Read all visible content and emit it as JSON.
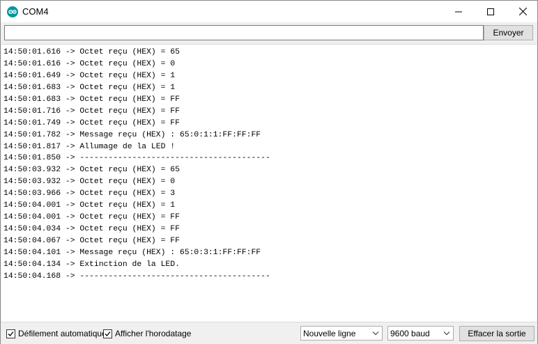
{
  "window": {
    "title": "COM4",
    "controls": {
      "minimize": "—",
      "maximize": "☐",
      "close": "✕"
    },
    "icon": "arduino-infinity-icon",
    "accent": "#00979c"
  },
  "send": {
    "input_value": "",
    "button_label": "Envoyer"
  },
  "serial_output": {
    "lines": [
      "14:50:01.616 -> Octet reçu (HEX) = 65",
      "14:50:01.616 -> Octet reçu (HEX) = 0",
      "14:50:01.649 -> Octet reçu (HEX) = 1",
      "14:50:01.683 -> Octet reçu (HEX) = 1",
      "14:50:01.683 -> Octet reçu (HEX) = FF",
      "14:50:01.716 -> Octet reçu (HEX) = FF",
      "14:50:01.749 -> Octet reçu (HEX) = FF",
      "14:50:01.782 -> Message reçu (HEX) : 65:0:1:1:FF:FF:FF",
      "14:50:01.817 -> Allumage de la LED !",
      "14:50:01.850 -> ----------------------------------------",
      "14:50:03.932 -> Octet reçu (HEX) = 65",
      "14:50:03.932 -> Octet reçu (HEX) = 0",
      "14:50:03.966 -> Octet reçu (HEX) = 3",
      "14:50:04.001 -> Octet reçu (HEX) = 1",
      "14:50:04.001 -> Octet reçu (HEX) = FF",
      "14:50:04.034 -> Octet reçu (HEX) = FF",
      "14:50:04.067 -> Octet reçu (HEX) = FF",
      "14:50:04.101 -> Message reçu (HEX) : 65:0:3:1:FF:FF:FF",
      "14:50:04.134 -> Extinction de la LED.",
      "14:50:04.168 -> ----------------------------------------"
    ]
  },
  "footer": {
    "autoscroll": {
      "label": "Défilement automatique",
      "checked": true
    },
    "timestamp": {
      "label": "Afficher l'horodatage",
      "checked": true
    },
    "line_ending": {
      "selected": "Nouvelle ligne"
    },
    "baud": {
      "selected": "9600 baud"
    },
    "clear_button": "Effacer la sortie"
  }
}
